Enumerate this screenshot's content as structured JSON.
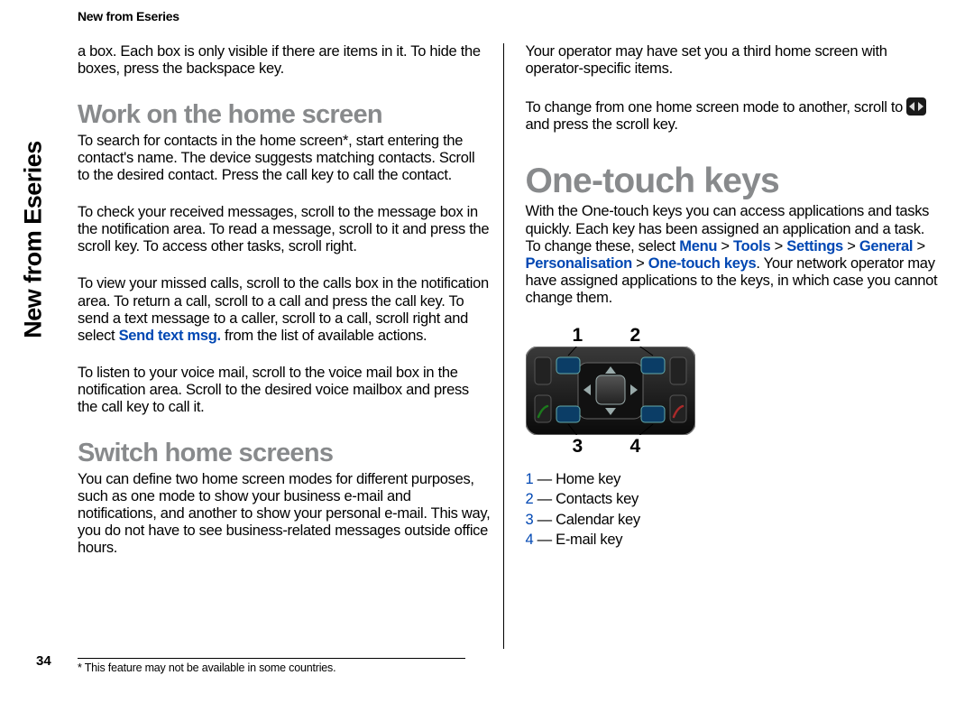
{
  "header": {
    "short_title": "New from Eseries",
    "side_label": "New from Eseries"
  },
  "page_number": "34",
  "footnote": "* This feature may not be available in some countries.",
  "col1": {
    "intro": "a box. Each box is only visible if there are items in it. To hide the boxes, press the backspace key.",
    "h_work": "Work on the home screen",
    "p_work": "To search for contacts in the home screen*, start entering the contact's name. The device suggests matching contacts. Scroll to the desired contact. Press the call key to call the contact.",
    "p_msgs": "To check your received messages, scroll to the message box in the notification area. To read a message, scroll to it and press the scroll key. To access other tasks, scroll right.",
    "p_calls_a": "To view your missed calls, scroll to the calls box in the notification area. To return a call, scroll to a call and press the call key. To send a text message to a caller, scroll to a call, scroll right and select ",
    "p_calls_link": "Send text msg.",
    "p_calls_b": " from the list of available actions.",
    "p_vm": "To listen to your voice mail, scroll to the voice mail box in the notification area. Scroll to the desired voice mailbox and press the call key to call it.",
    "h_switch": "Switch home screens",
    "p_switch": "You can define two home screen modes for different purposes, such as one mode to show your business e-mail and notifications, and another to show your personal e-mail. This way, you do not have to see business-related messages outside office hours."
  },
  "col2": {
    "p_operator": "Your operator may have set you a third home screen with operator-specific items.",
    "p_change_a": "To change from one home screen mode to another, scroll to ",
    "p_change_b": " and press the scroll key.",
    "h_onetouch": "One-touch keys",
    "p_one_a": "With the One-touch keys you can access applications and tasks quickly. Each key has been assigned an application and a task. To change these, select ",
    "menu": "Menu",
    "gt": " > ",
    "tools": "Tools",
    "settings": "Settings",
    "general": "General",
    "personal": "Personalisation",
    "onekeys": "One-touch keys",
    "p_one_b": ". Your network operator may have assigned applications to the keys, in which case you cannot change them.",
    "fig_labels": {
      "n1": "1",
      "n2": "2",
      "n3": "3",
      "n4": "4"
    },
    "legend": {
      "l1n": "1",
      "l1t": " — Home key",
      "l2n": "2",
      "l2t": " — Contacts key",
      "l3n": "3",
      "l3t": " — Calendar key",
      "l4n": "4",
      "l4t": " — E-mail key"
    }
  }
}
